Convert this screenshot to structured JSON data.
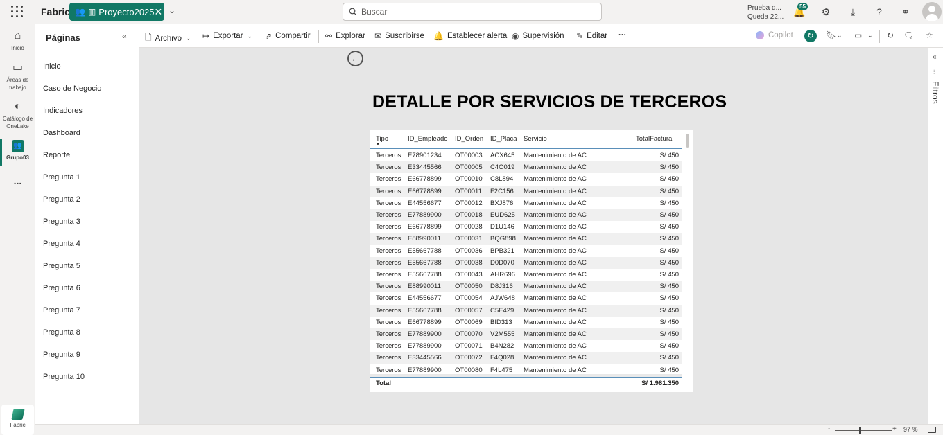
{
  "topbar": {
    "brand": "Fabric",
    "workspace_tab": "Proyecto2025",
    "search_placeholder": "Buscar",
    "trial_line1": "Prueba d...",
    "trial_line2": "Queda 22...",
    "notifications_count": "55"
  },
  "leftrail": {
    "home": "Inicio",
    "workspaces": "Áreas de trabajo",
    "catalog": "Catálogo de OneLake",
    "group": "Grupo03",
    "more": "...",
    "fabric": "Fabric"
  },
  "pages": {
    "title": "Páginas",
    "items": [
      "Inicio",
      "Caso de Negocio",
      "Indicadores",
      "Dashboard",
      "Reporte",
      "Pregunta 1",
      "Pregunta 2",
      "Pregunta 3",
      "Pregunta 4",
      "Pregunta 5",
      "Pregunta 6",
      "Pregunta 7",
      "Pregunta 8",
      "Pregunta 9",
      "Pregunta 10"
    ]
  },
  "commandbar": {
    "archivo": "Archivo",
    "exportar": "Exportar",
    "compartir": "Compartir",
    "explorar": "Explorar",
    "suscribirse": "Suscribirse",
    "alerta": "Establecer alerta",
    "supervision": "Supervisión",
    "editar": "Editar",
    "more": "···",
    "copilot": "Copilot"
  },
  "report": {
    "title": "DETALLE POR SERVICIOS DE TERCEROS",
    "columns": [
      "Tipo",
      "ID_Empleado",
      "ID_Orden",
      "ID_Placa",
      "Servicio",
      "TotalFactura"
    ],
    "rows": [
      [
        "Terceros",
        "E78901234",
        "OT00003",
        "ACX645",
        "Mantenimiento de AC",
        "S/ 450"
      ],
      [
        "Terceros",
        "E33445566",
        "OT00005",
        "C4O019",
        "Mantenimiento de AC",
        "S/ 450"
      ],
      [
        "Terceros",
        "E66778899",
        "OT00010",
        "C8L894",
        "Mantenimiento de AC",
        "S/ 450"
      ],
      [
        "Terceros",
        "E66778899",
        "OT00011",
        "F2C156",
        "Mantenimiento de AC",
        "S/ 450"
      ],
      [
        "Terceros",
        "E44556677",
        "OT00012",
        "BXJ876",
        "Mantenimiento de AC",
        "S/ 450"
      ],
      [
        "Terceros",
        "E77889900",
        "OT00018",
        "EUD625",
        "Mantenimiento de AC",
        "S/ 450"
      ],
      [
        "Terceros",
        "E66778899",
        "OT00028",
        "D1U146",
        "Mantenimiento de AC",
        "S/ 450"
      ],
      [
        "Terceros",
        "E88990011",
        "OT00031",
        "BQG898",
        "Mantenimiento de AC",
        "S/ 450"
      ],
      [
        "Terceros",
        "E55667788",
        "OT00036",
        "BPB321",
        "Mantenimiento de AC",
        "S/ 450"
      ],
      [
        "Terceros",
        "E55667788",
        "OT00038",
        "D0D070",
        "Mantenimiento de AC",
        "S/ 450"
      ],
      [
        "Terceros",
        "E55667788",
        "OT00043",
        "AHR696",
        "Mantenimiento de AC",
        "S/ 450"
      ],
      [
        "Terceros",
        "E88990011",
        "OT00050",
        "D8J316",
        "Mantenimiento de AC",
        "S/ 450"
      ],
      [
        "Terceros",
        "E44556677",
        "OT00054",
        "AJW648",
        "Mantenimiento de AC",
        "S/ 450"
      ],
      [
        "Terceros",
        "E55667788",
        "OT00057",
        "C5E429",
        "Mantenimiento de AC",
        "S/ 450"
      ],
      [
        "Terceros",
        "E66778899",
        "OT00069",
        "BID313",
        "Mantenimiento de AC",
        "S/ 450"
      ],
      [
        "Terceros",
        "E77889900",
        "OT00070",
        "V2M555",
        "Mantenimiento de AC",
        "S/ 450"
      ],
      [
        "Terceros",
        "E77889900",
        "OT00071",
        "B4N282",
        "Mantenimiento de AC",
        "S/ 450"
      ],
      [
        "Terceros",
        "E33445566",
        "OT00072",
        "F4Q028",
        "Mantenimiento de AC",
        "S/ 450"
      ],
      [
        "Terceros",
        "E77889900",
        "OT00080",
        "F4L475",
        "Mantenimiento de AC",
        "S/ 450"
      ]
    ],
    "total_label": "Total",
    "total_value": "S/ 1.981.350"
  },
  "filters_label": "Filtros",
  "status": {
    "zoom_level": "97 %",
    "zoom_minus": "-",
    "zoom_plus": "+"
  },
  "colors": {
    "accent": "#117865",
    "canvas_bg": "#e6e6e6",
    "header_rule": "#5a8fb9"
  }
}
